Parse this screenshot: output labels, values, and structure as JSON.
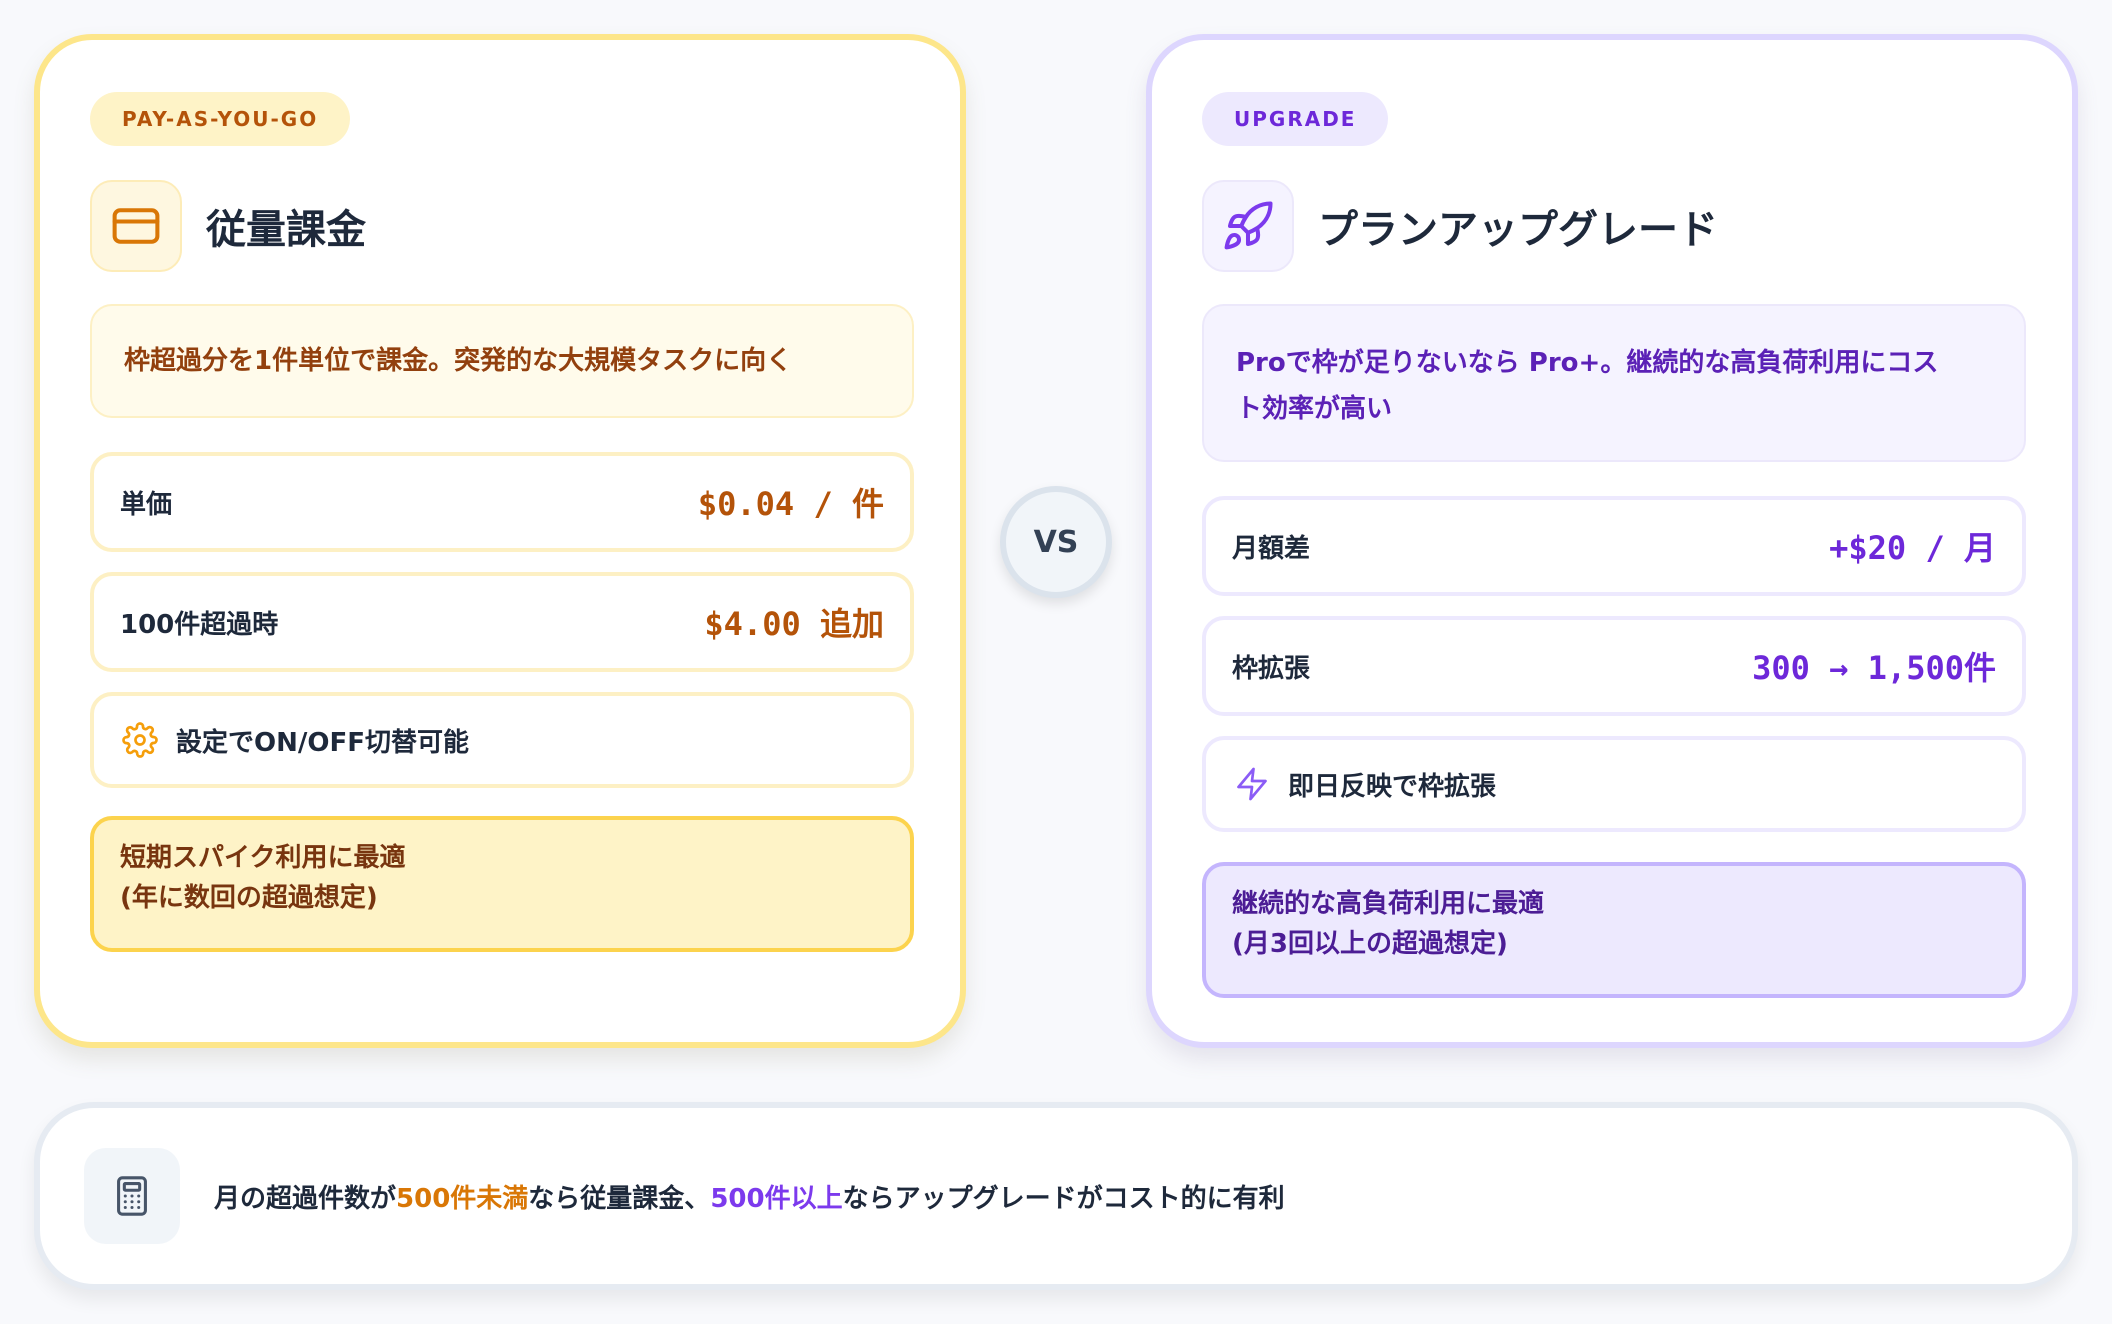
{
  "left_card": {
    "tag": "PAY-AS-YOU-GO",
    "icon": "credit-card-icon",
    "title": "従量課金",
    "description": "枠超過分を1件単位で課金。突発的な大規模タスクに向く",
    "rows": [
      {
        "label": "単価",
        "value": "$0.04 / 件"
      },
      {
        "label": "100件超過時",
        "value": "$4.00 追加"
      }
    ],
    "feature": {
      "icon": "gear-icon",
      "text": "設定でON/OFF切替可能"
    },
    "highlight": {
      "line1": "短期スパイク利用に最適",
      "line2": "(年に数回の超過想定)"
    }
  },
  "vs_label": "VS",
  "right_card": {
    "tag": "UPGRADE",
    "icon": "rocket-icon",
    "title": "プランアップグレード",
    "description_line1": "Proで枠が足りないなら Pro+。継続的な高負荷利用にコス",
    "description_line2": "ト効率が高い",
    "rows": [
      {
        "label": "月額差",
        "value": "+$20 / 月"
      },
      {
        "label": "枠拡張",
        "value": "300 → 1,500件"
      }
    ],
    "feature": {
      "icon": "lightning-icon",
      "text": "即日反映で枠拡張"
    },
    "highlight": {
      "line1": "継続的な高負荷利用に最適",
      "line2": "(月3回以上の超過想定)"
    }
  },
  "summary": {
    "icon": "calculator-icon",
    "part1": "月の超過件数が",
    "threshold_low": "500件未満",
    "part2": "なら従量課金、",
    "threshold_high": "500件以上",
    "part3": "ならアップグレードがコスト的に有利"
  },
  "colors": {
    "amber_accent": "#b45309",
    "purple_accent": "#6d28d9",
    "amber_border": "#fde68a",
    "purple_border": "#ddd6fe"
  }
}
